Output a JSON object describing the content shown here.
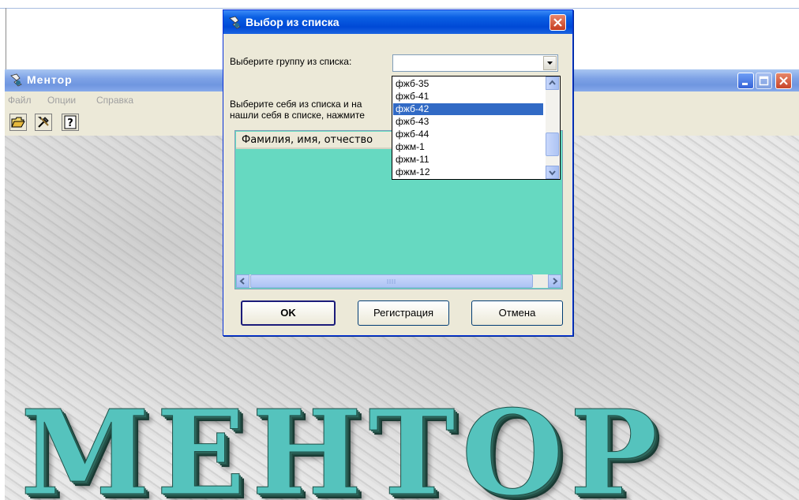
{
  "main_window": {
    "title": "Ментор",
    "menu": [
      "Файл",
      "Опции",
      "Справка"
    ],
    "toolbar_icons": [
      "open-folder-icon",
      "tools-icon",
      "help-icon"
    ],
    "logo_text": "МЕНТОР"
  },
  "dialog": {
    "title": "Выбор из списка",
    "group_label": "Выберите группу из списка:",
    "group_value": "",
    "instruction_line1": "Выберите себя из списка и на",
    "instruction_line2": "нашли себя в списке, нажмите",
    "list_column_header": "Фамилия, имя, отчество",
    "buttons": {
      "ok": "OK",
      "register": "Регистрация",
      "cancel": "Отмена"
    }
  },
  "dropdown": {
    "items": [
      "фжб-35",
      "фжб-41",
      "фжб-42",
      "фжб-43",
      "фжб-44",
      "фжм-1",
      "фжм-11",
      "фжм-12"
    ],
    "selected": "фжб-42"
  },
  "colors": {
    "selection": "#316ac5",
    "list_background": "#66d9c1",
    "dialog_title": "#0a5fe3",
    "logo": "#55c3bd"
  }
}
